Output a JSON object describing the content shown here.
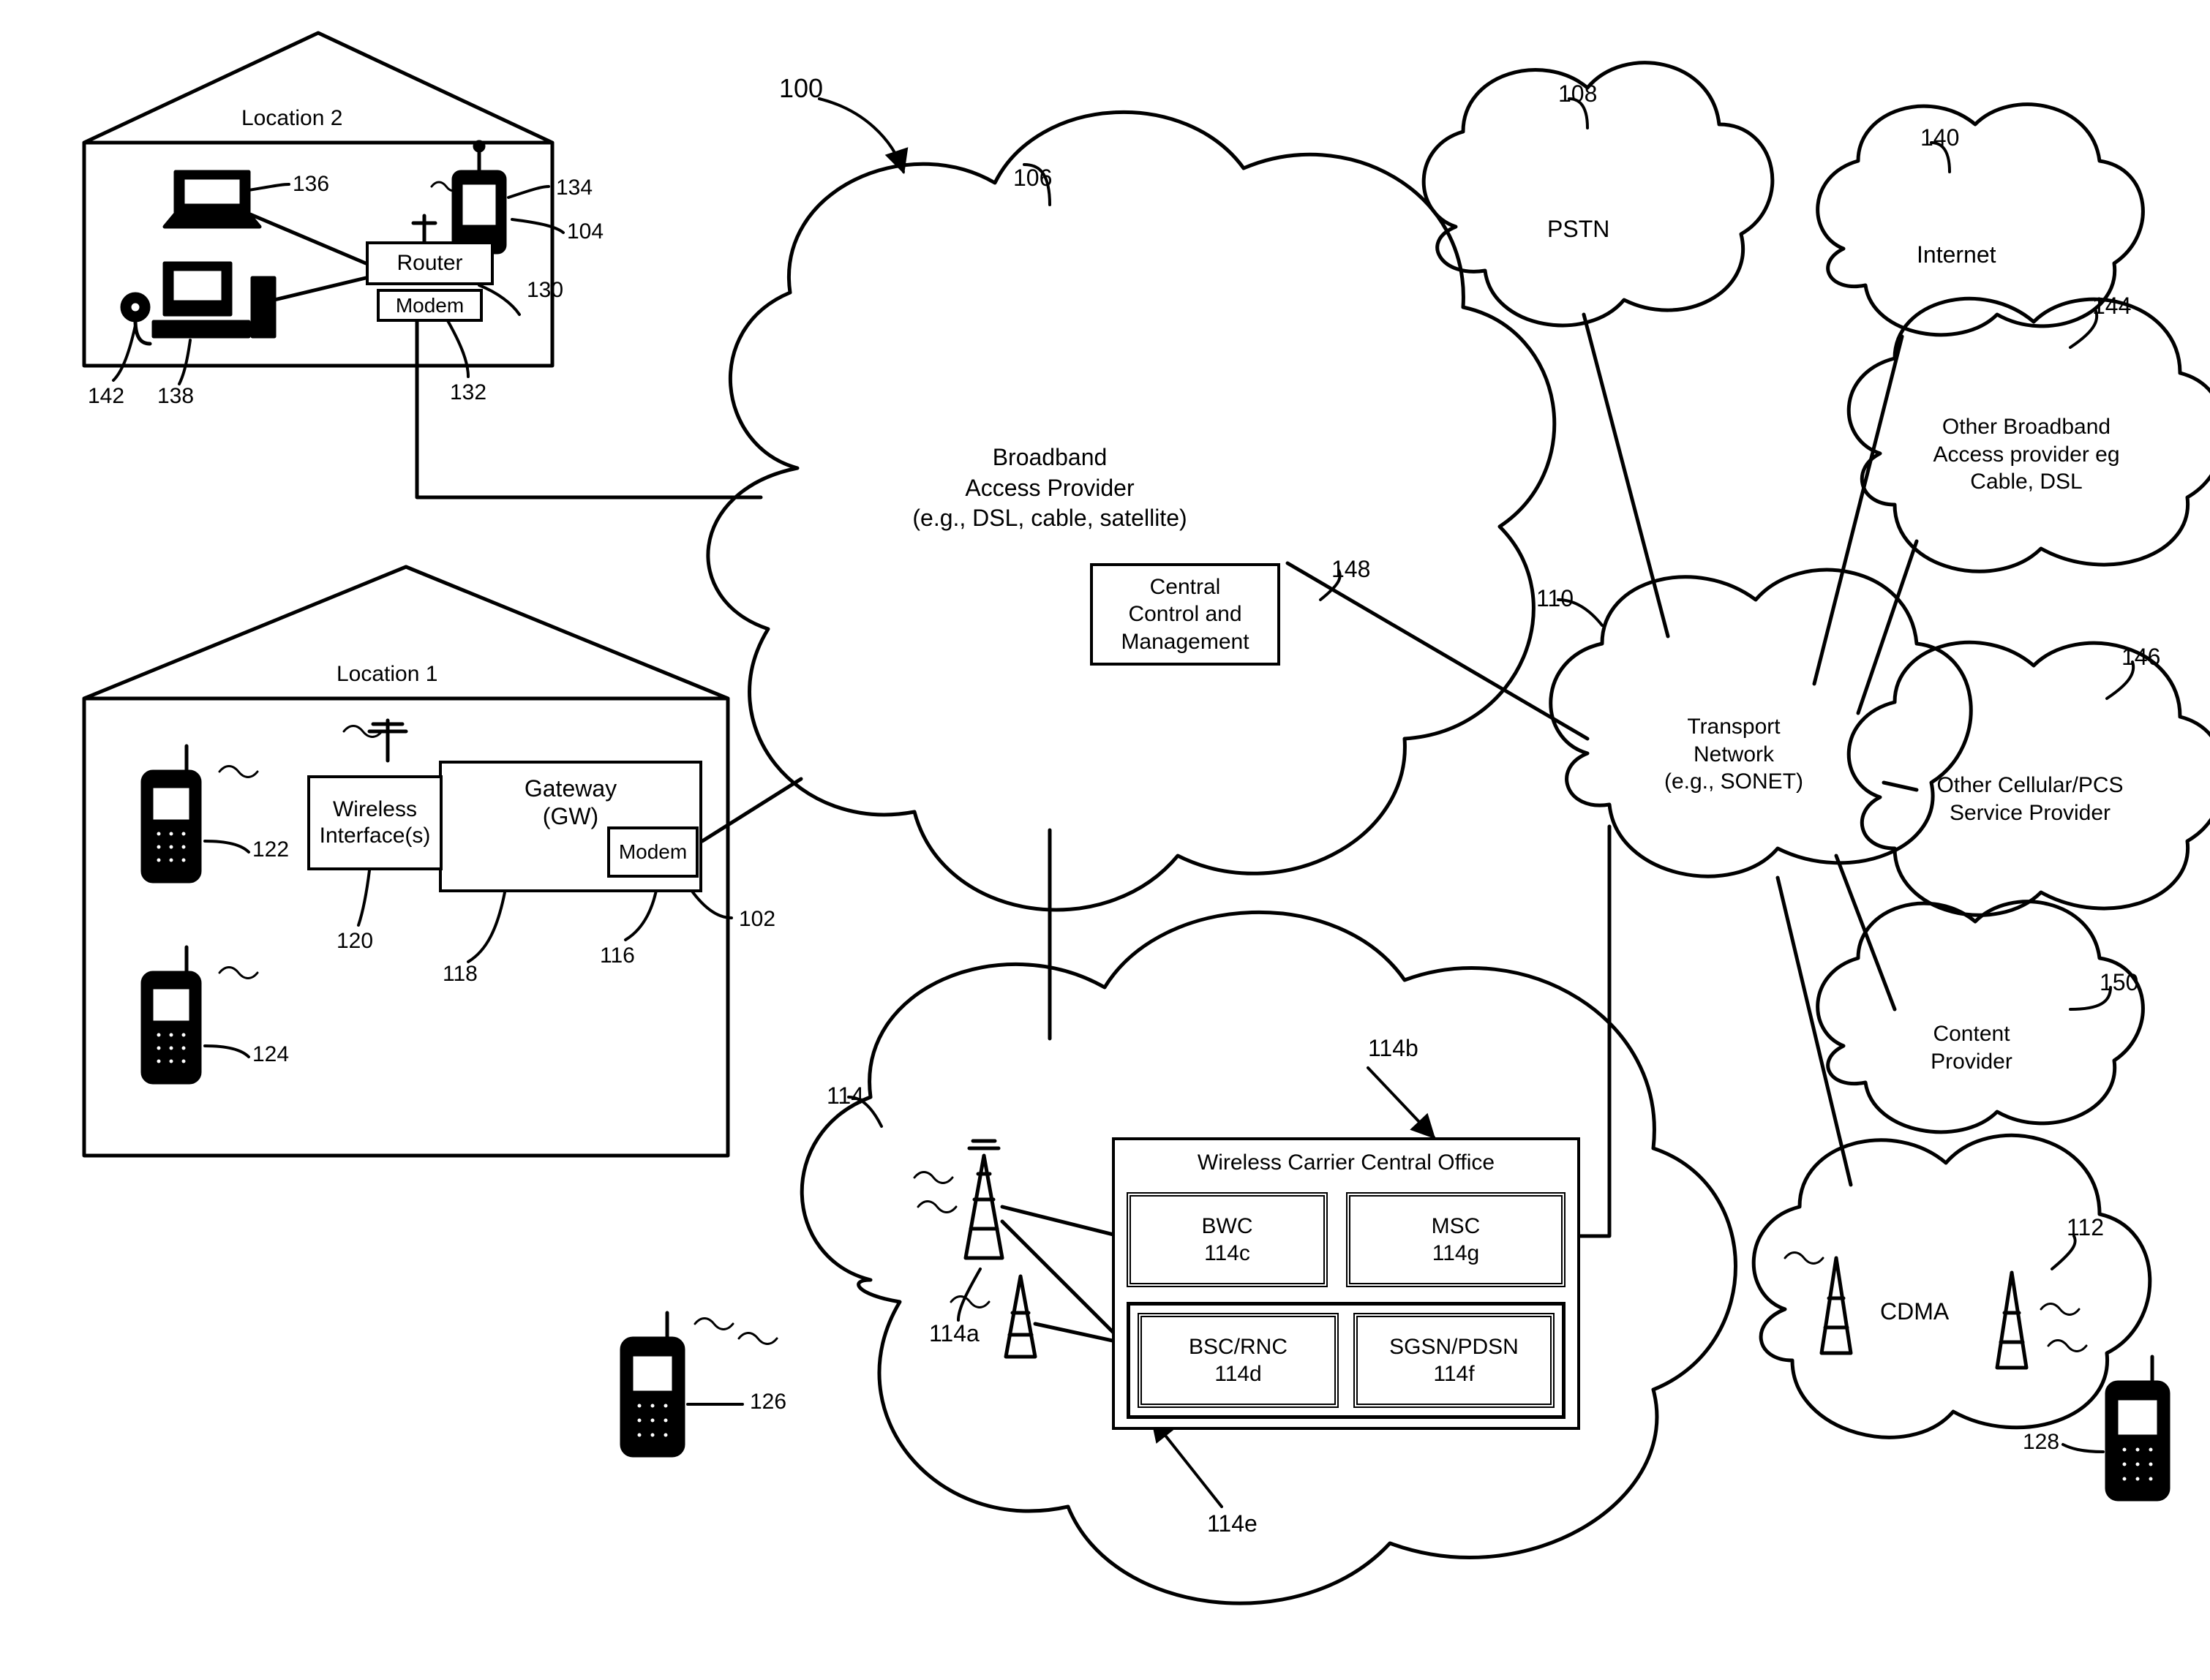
{
  "figure_ref": "100",
  "locations": {
    "loc2": {
      "title": "Location 2",
      "router": "Router",
      "modem": "Modem",
      "refs": {
        "router": "130",
        "modem": "132",
        "pda": "134",
        "pda_outer": "104",
        "laptop": "136",
        "pc": "138",
        "webcam": "142"
      }
    },
    "loc1": {
      "title": "Location 1",
      "gateway_title": "Gateway\n(GW)",
      "wireless_if": "Wireless\nInterface(s)",
      "modem": "Modem",
      "refs": {
        "modem": "116",
        "gateway": "118",
        "wireless_if": "120",
        "phone_top": "122",
        "phone_bottom": "124",
        "loc1": "102"
      }
    }
  },
  "clouds": {
    "broadband": {
      "title": "Broadband\nAccess Provider\n(e.g., DSL, cable, satellite)",
      "ccm": "Central\nControl and\nManagement",
      "refs": {
        "cloud": "106",
        "ccm": "148"
      }
    },
    "pstn": {
      "title": "PSTN",
      "ref": "108"
    },
    "internet": {
      "title": "Internet",
      "ref": "140"
    },
    "other_bb": {
      "title": "Other Broadband\nAccess provider eg\nCable, DSL",
      "ref": "144"
    },
    "transport": {
      "title": "Transport\nNetwork\n(e.g., SONET)",
      "ref": "110"
    },
    "other_cell": {
      "title": "Other Cellular/PCS\nService Provider",
      "ref": "146"
    },
    "content": {
      "title": "Content\nProvider",
      "ref": "150"
    },
    "cdma": {
      "title": "CDMA",
      "ref": "112"
    },
    "wireless_carrier": {
      "office_title": "Wireless Carrier Central Office",
      "bwc": "BWC\n114c",
      "msc": "MSC\n114g",
      "bsc": "BSC/RNC\n114d",
      "sgsn": "SGSN/PDSN\n114f",
      "refs": {
        "cloud": "114",
        "tower": "114a",
        "office": "114b",
        "inner": "114e"
      }
    }
  },
  "free_phones": {
    "p126": "126",
    "p128": "128"
  },
  "chart_data": {
    "type": "diagram",
    "nodes": [
      "Location 2 (Router, Modem, Laptop 136, PDA 134/104, PC 138, Webcam 142)",
      "Location 1 (Gateway 118: Wireless Interface(s) 120, Modem 116; Phones 122,124)",
      "Broadband Access Provider 106 (Central Control and Management 148)",
      "Wireless Carrier 114 (Tower 114a, Central Office 114b: BWC 114c, MSC 114g, BSC/RNC 114d, SGSN/PDSN 114f; inner 114e)",
      "PSTN 108",
      "Transport Network 110",
      "Internet 140",
      "Other Broadband Access provider 144",
      "Other Cellular/PCS Service Provider 146",
      "Content Provider 150",
      "CDMA 112",
      "Phone 126",
      "Phone 128"
    ],
    "edges": [
      [
        "Location 2 Modem",
        "Broadband Access Provider"
      ],
      [
        "Location 1 Modem",
        "Broadband Access Provider"
      ],
      [
        "Broadband Access Provider",
        "Wireless Carrier"
      ],
      [
        "Broadband Access Provider",
        "Transport Network"
      ],
      [
        "Wireless Carrier MSC",
        "Transport Network"
      ],
      [
        "PSTN",
        "Transport Network"
      ],
      [
        "Transport Network",
        "Internet"
      ],
      [
        "Transport Network",
        "Other Broadband Access provider"
      ],
      [
        "Transport Network",
        "Other Cellular/PCS Service Provider"
      ],
      [
        "Transport Network",
        "Content Provider"
      ],
      [
        "Transport Network",
        "CDMA"
      ],
      [
        "Tower 114a",
        "BWC"
      ],
      [
        "Tower 114a",
        "BSC/RNC"
      ],
      [
        "Phone 126",
        "Tower 114a (RF)"
      ],
      [
        "Phone 128",
        "CDMA tower (RF)"
      ],
      [
        "Phones 122/124",
        "Wireless Interface(s) (RF)"
      ]
    ]
  }
}
